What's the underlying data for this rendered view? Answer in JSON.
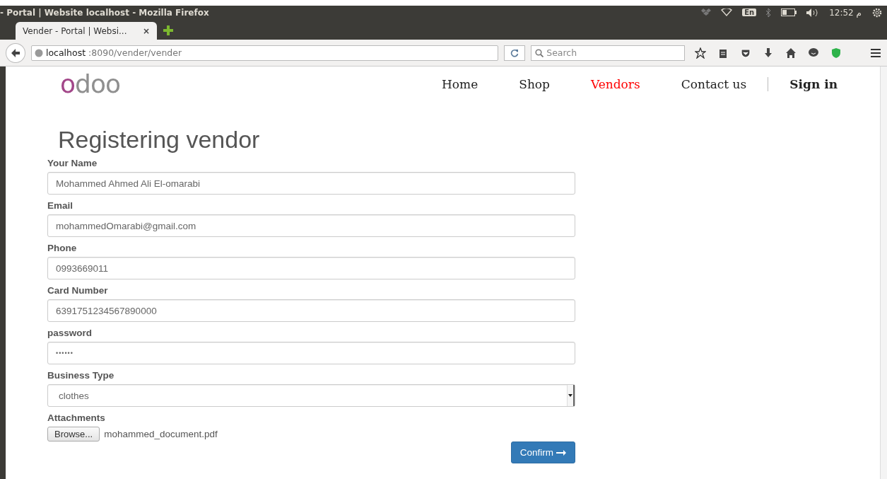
{
  "window": {
    "title": "- Portal | Website localhost - Mozilla Firefox"
  },
  "tray": {
    "keyboard": "En",
    "am_pm": "م",
    "time": "12:52"
  },
  "tabs": [
    {
      "label": "Vender - Portal | Websi...",
      "close": "×",
      "selected": true
    }
  ],
  "address_bar": {
    "host": "localhost",
    "path": ":8090/vender/vender"
  },
  "search": {
    "placeholder": "Search"
  },
  "site": {
    "logo": {
      "accent": "o",
      "rest": "doo"
    },
    "nav": [
      {
        "label": "Home",
        "kind": "link",
        "selected": false
      },
      {
        "label": "Shop",
        "kind": "link",
        "selected": false
      },
      {
        "label": "Vendors",
        "kind": "link",
        "selected": true
      },
      {
        "label": "Contact us",
        "kind": "link",
        "selected": false
      },
      {
        "label": "Sign in",
        "kind": "sign-in",
        "selected": false
      }
    ]
  },
  "form": {
    "title": "Registering vendor",
    "fields": [
      {
        "label": "Your Name",
        "kind": "text",
        "value": "Mohammed Ahmed Ali El-omarabi"
      },
      {
        "label": "Email",
        "kind": "text",
        "value": "mohammedOmarabi@gmail.com"
      },
      {
        "label": "Phone",
        "kind": "text",
        "value": "0993669011"
      },
      {
        "label": "Card Number",
        "kind": "text",
        "value": "6391751234567890000"
      },
      {
        "label": "password",
        "kind": "password",
        "value": "••••••"
      },
      {
        "label": "Business Type",
        "kind": "select",
        "value": "clothes"
      },
      {
        "label": "Attachments",
        "kind": "file",
        "button": "Browse...",
        "value": "mohammed_document.pdf"
      }
    ],
    "submit": "Confirm"
  }
}
